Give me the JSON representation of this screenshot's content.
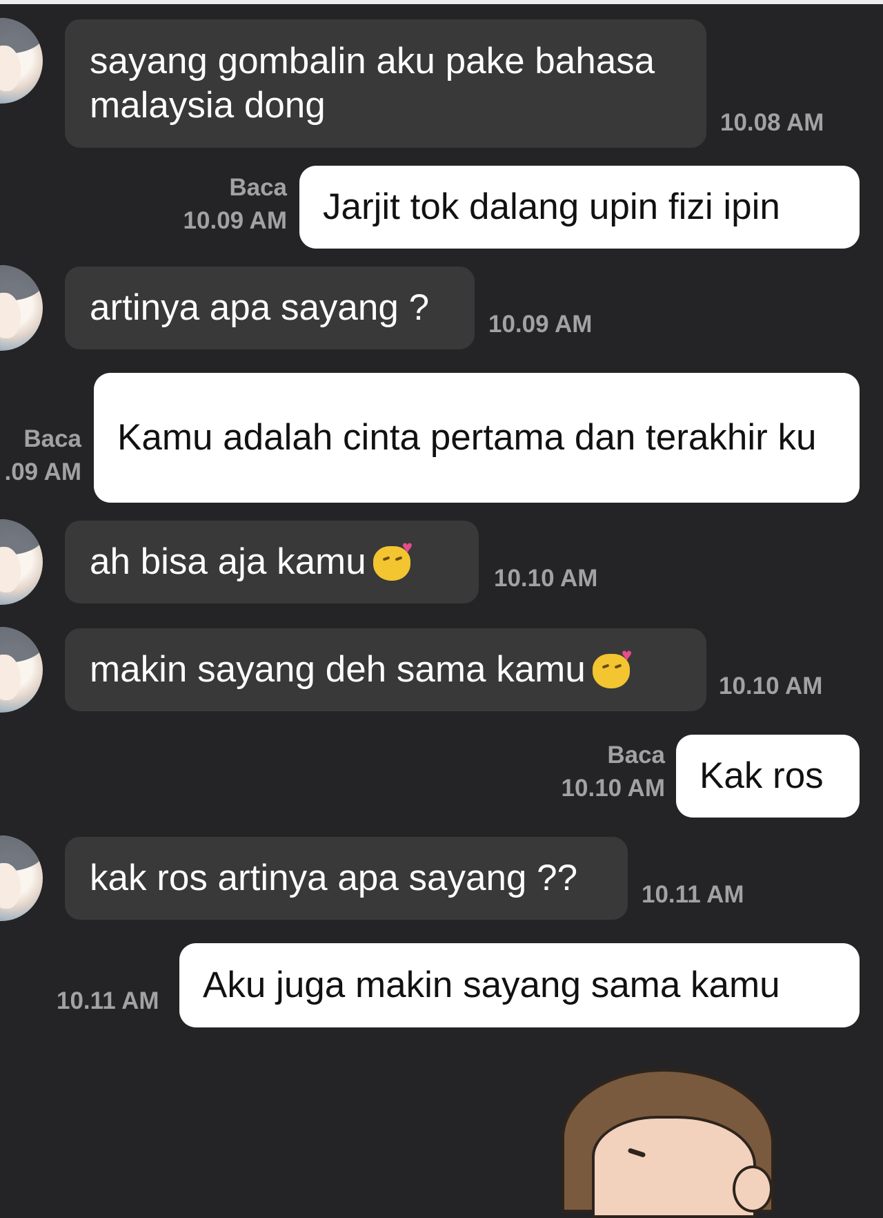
{
  "chat": {
    "messages": [
      {
        "from": "them",
        "text": "sayang gombalin aku pake bahasa malaysia dong",
        "time": "10.08 AM"
      },
      {
        "from": "me",
        "text": "Jarjit tok dalang upin fizi ipin",
        "time": "10.09 AM",
        "status": "Baca"
      },
      {
        "from": "them",
        "text": "artinya apa sayang ?",
        "time": "10.09 AM"
      },
      {
        "from": "me",
        "text": "Kamu adalah cinta pertama dan terakhir ku",
        "time": ".09 AM",
        "status": "Baca"
      },
      {
        "from": "them",
        "text": "ah bisa aja kamu",
        "emoji": "kissing-face-with-heart-emoji",
        "time": "10.10 AM"
      },
      {
        "from": "them",
        "text": "makin sayang deh sama kamu",
        "emoji": "kissing-face-with-heart-emoji",
        "time": "10.10 AM"
      },
      {
        "from": "me",
        "text": "Kak ros",
        "time": "10.10 AM",
        "status": "Baca"
      },
      {
        "from": "them",
        "text": "kak ros artinya apa sayang ??",
        "time": "10.11 AM"
      },
      {
        "from": "me",
        "text": "Aku juga makin sayang sama kamu",
        "time": "10.11 AM"
      }
    ]
  },
  "colors": {
    "background": "#242426",
    "incoming_bubble": "#393939",
    "outgoing_bubble": "#ffffff",
    "timestamp": "#a2a2a4"
  }
}
